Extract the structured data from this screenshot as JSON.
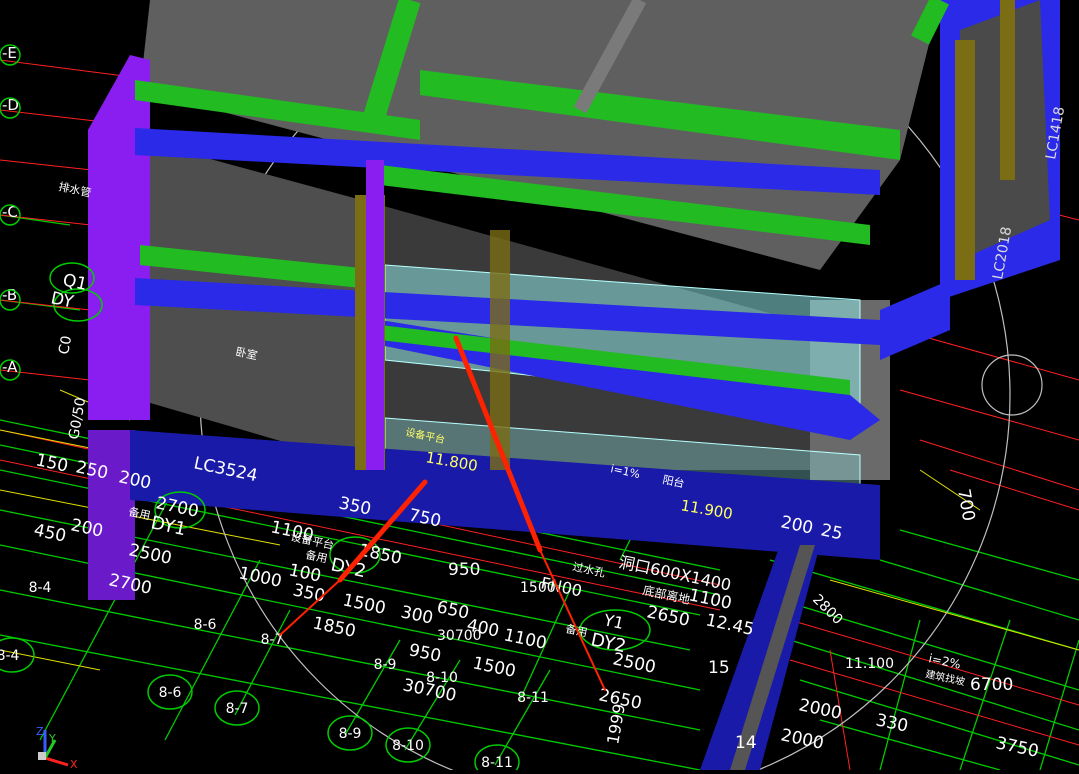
{
  "colors": {
    "background": "#000000",
    "grid_green": "#00cc00",
    "grid_red": "#ff2020",
    "wall_blue": "#2a2ae8",
    "slab_green": "#22bb22",
    "roof_gray": "#5f5f5f",
    "column_purple": "#8a1ef0",
    "glass_cyan": "#8fe6e6",
    "pointer_red": "#ff2200"
  },
  "axis_labels_left": [
    "-E",
    "-D",
    "-C",
    "-B",
    "-A"
  ],
  "grid_bubbles": [
    "8-4",
    "8-6",
    "8-7",
    "8-9",
    "8-10",
    "8-11",
    "8-4",
    "8-6",
    "8-7",
    "8-9",
    "8-10",
    "8-11"
  ],
  "dimensions": [
    "150",
    "250",
    "200",
    "450",
    "200",
    "2500",
    "2700",
    "2700",
    "1100",
    "1000",
    "100",
    "350",
    "1850",
    "1500",
    "300",
    "650",
    "400",
    "1100",
    "30700",
    "950",
    "1500",
    "30700",
    "950",
    "1500",
    "2650",
    "2500",
    "2650",
    "2000",
    "2000",
    "330",
    "3750",
    "6700",
    "11.100",
    "12.45",
    "15",
    "14",
    "700",
    "350",
    "750",
    "1850",
    "1100",
    "200",
    "25",
    "11.800",
    "11.900",
    "2650",
    "1100"
  ],
  "cad_labels": {
    "window_lc3524": "LC3524",
    "opening": "洞口600X1400",
    "bottom_elev": "底部离地",
    "dy1": "DY1",
    "dy2": "DY2",
    "dy2b": "DY2",
    "y1": "Y1",
    "q1": "Q1",
    "dy": "DY",
    "slope1": "i=1%",
    "slope2": "i=2%",
    "drain": "排水管",
    "bedroom": "卧室",
    "equip": "设备平台",
    "balcony": "阳台",
    "standby": "备用",
    "standby2": "备用",
    "standby3": "备用",
    "stair_equip": "设备平台",
    "lc_right": "LC1418",
    "lc2018": "LC2018",
    "drain_pipe": "过水孔",
    "waterproof": "建筑找坡",
    "fn": "FN00",
    "bottom_right": "1999",
    "c0": "C0",
    "gv": "G0/50",
    "num_2800": "2800"
  },
  "ucs_icon": {
    "z": "Z",
    "y": "Y",
    "x": "X"
  }
}
